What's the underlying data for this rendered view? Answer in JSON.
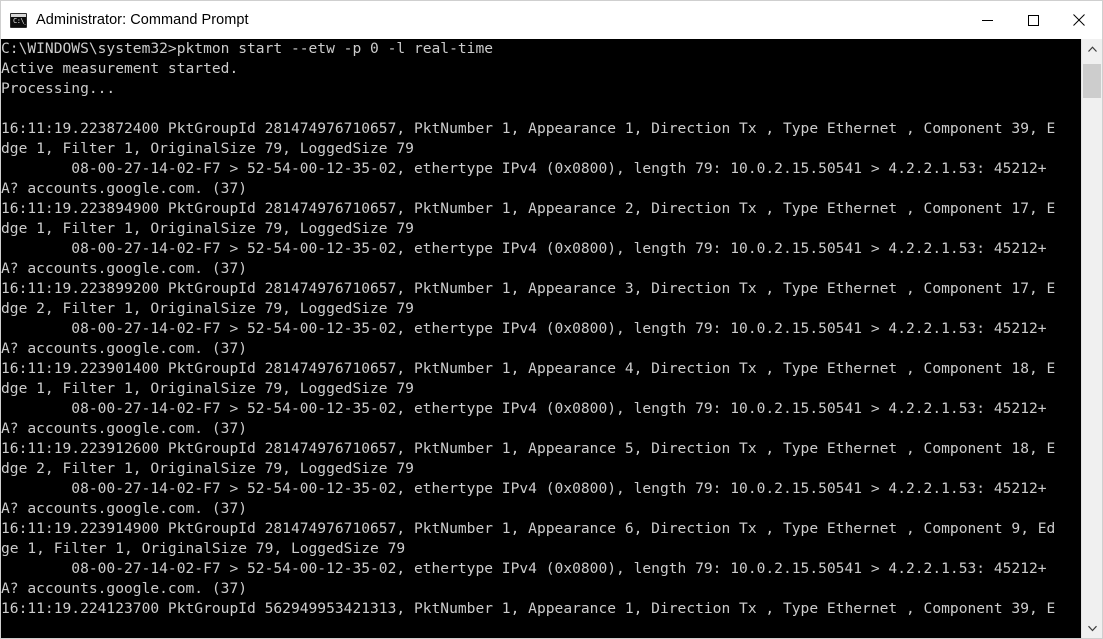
{
  "window": {
    "title": "Administrator: Command Prompt",
    "icon": "cmd-icon",
    "icon_glyph": "C:\\_",
    "background_color": "#000000",
    "text_color": "#cccccc",
    "titlebar_color": "#ffffff",
    "controls": [
      {
        "name": "minimize",
        "label": "Minimize"
      },
      {
        "name": "maximize",
        "label": "Maximize"
      },
      {
        "name": "close",
        "label": "Close"
      }
    ]
  },
  "scrollbar": {
    "up_arrow": "scroll-up",
    "down_arrow": "scroll-down",
    "thumb_position_percent": 1,
    "thumb_size_percent": 6
  },
  "console": {
    "prompt": "C:\\WINDOWS\\system32>",
    "command": "pktmon start --etw -p 0 -l real-time",
    "lines": [
      "C:\\WINDOWS\\system32>pktmon start --etw -p 0 -l real-time",
      "Active measurement started.",
      "Processing...",
      "",
      "16:11:19.223872400 PktGroupId 281474976710657, PktNumber 1, Appearance 1, Direction Tx , Type Ethernet , Component 39, E",
      "dge 1, Filter 1, OriginalSize 79, LoggedSize 79",
      "        08-00-27-14-02-F7 > 52-54-00-12-35-02, ethertype IPv4 (0x0800), length 79: 10.0.2.15.50541 > 4.2.2.1.53: 45212+",
      "A? accounts.google.com. (37)",
      "16:11:19.223894900 PktGroupId 281474976710657, PktNumber 1, Appearance 2, Direction Tx , Type Ethernet , Component 17, E",
      "dge 1, Filter 1, OriginalSize 79, LoggedSize 79",
      "        08-00-27-14-02-F7 > 52-54-00-12-35-02, ethertype IPv4 (0x0800), length 79: 10.0.2.15.50541 > 4.2.2.1.53: 45212+",
      "A? accounts.google.com. (37)",
      "16:11:19.223899200 PktGroupId 281474976710657, PktNumber 1, Appearance 3, Direction Tx , Type Ethernet , Component 17, E",
      "dge 2, Filter 1, OriginalSize 79, LoggedSize 79",
      "        08-00-27-14-02-F7 > 52-54-00-12-35-02, ethertype IPv4 (0x0800), length 79: 10.0.2.15.50541 > 4.2.2.1.53: 45212+",
      "A? accounts.google.com. (37)",
      "16:11:19.223901400 PktGroupId 281474976710657, PktNumber 1, Appearance 4, Direction Tx , Type Ethernet , Component 18, E",
      "dge 1, Filter 1, OriginalSize 79, LoggedSize 79",
      "        08-00-27-14-02-F7 > 52-54-00-12-35-02, ethertype IPv4 (0x0800), length 79: 10.0.2.15.50541 > 4.2.2.1.53: 45212+",
      "A? accounts.google.com. (37)",
      "16:11:19.223912600 PktGroupId 281474976710657, PktNumber 1, Appearance 5, Direction Tx , Type Ethernet , Component 18, E",
      "dge 2, Filter 1, OriginalSize 79, LoggedSize 79",
      "        08-00-27-14-02-F7 > 52-54-00-12-35-02, ethertype IPv4 (0x0800), length 79: 10.0.2.15.50541 > 4.2.2.1.53: 45212+",
      "A? accounts.google.com. (37)",
      "16:11:19.223914900 PktGroupId 281474976710657, PktNumber 1, Appearance 6, Direction Tx , Type Ethernet , Component 9, Ed",
      "ge 1, Filter 1, OriginalSize 79, LoggedSize 79",
      "        08-00-27-14-02-F7 > 52-54-00-12-35-02, ethertype IPv4 (0x0800), length 79: 10.0.2.15.50541 > 4.2.2.1.53: 45212+",
      "A? accounts.google.com. (37)",
      "16:11:19.224123700 PktGroupId 562949953421313, PktNumber 1, Appearance 1, Direction Tx , Type Ethernet , Component 39, E"
    ],
    "status_messages": [
      "Active measurement started.",
      "Processing..."
    ],
    "packets": [
      {
        "timestamp": "16:11:19.223872400",
        "pkt_group_id": "281474976710657",
        "pkt_number": "1",
        "appearance": "1",
        "direction": "Tx",
        "type": "Ethernet",
        "component": "39",
        "edge": "1",
        "filter": "1",
        "original_size": "79",
        "logged_size": "79",
        "src_mac": "08-00-27-14-02-F7",
        "dst_mac": "52-54-00-12-35-02",
        "ethertype": "IPv4 (0x0800)",
        "length": "79",
        "src_ip_port": "10.0.2.15.50541",
        "dst_ip_port": "4.2.2.1.53",
        "dns_query": "45212+ A? accounts.google.com. (37)"
      },
      {
        "timestamp": "16:11:19.223894900",
        "pkt_group_id": "281474976710657",
        "pkt_number": "1",
        "appearance": "2",
        "direction": "Tx",
        "type": "Ethernet",
        "component": "17",
        "edge": "1",
        "filter": "1",
        "original_size": "79",
        "logged_size": "79",
        "src_mac": "08-00-27-14-02-F7",
        "dst_mac": "52-54-00-12-35-02",
        "ethertype": "IPv4 (0x0800)",
        "length": "79",
        "src_ip_port": "10.0.2.15.50541",
        "dst_ip_port": "4.2.2.1.53",
        "dns_query": "45212+ A? accounts.google.com. (37)"
      },
      {
        "timestamp": "16:11:19.223899200",
        "pkt_group_id": "281474976710657",
        "pkt_number": "1",
        "appearance": "3",
        "direction": "Tx",
        "type": "Ethernet",
        "component": "17",
        "edge": "2",
        "filter": "1",
        "original_size": "79",
        "logged_size": "79",
        "src_mac": "08-00-27-14-02-F7",
        "dst_mac": "52-54-00-12-35-02",
        "ethertype": "IPv4 (0x0800)",
        "length": "79",
        "src_ip_port": "10.0.2.15.50541",
        "dst_ip_port": "4.2.2.1.53",
        "dns_query": "45212+ A? accounts.google.com. (37)"
      },
      {
        "timestamp": "16:11:19.223901400",
        "pkt_group_id": "281474976710657",
        "pkt_number": "1",
        "appearance": "4",
        "direction": "Tx",
        "type": "Ethernet",
        "component": "18",
        "edge": "1",
        "filter": "1",
        "original_size": "79",
        "logged_size": "79",
        "src_mac": "08-00-27-14-02-F7",
        "dst_mac": "52-54-00-12-35-02",
        "ethertype": "IPv4 (0x0800)",
        "length": "79",
        "src_ip_port": "10.0.2.15.50541",
        "dst_ip_port": "4.2.2.1.53",
        "dns_query": "45212+ A? accounts.google.com. (37)"
      },
      {
        "timestamp": "16:11:19.223912600",
        "pkt_group_id": "281474976710657",
        "pkt_number": "1",
        "appearance": "5",
        "direction": "Tx",
        "type": "Ethernet",
        "component": "18",
        "edge": "2",
        "filter": "1",
        "original_size": "79",
        "logged_size": "79",
        "src_mac": "08-00-27-14-02-F7",
        "dst_mac": "52-54-00-12-35-02",
        "ethertype": "IPv4 (0x0800)",
        "length": "79",
        "src_ip_port": "10.0.2.15.50541",
        "dst_ip_port": "4.2.2.1.53",
        "dns_query": "45212+ A? accounts.google.com. (37)"
      },
      {
        "timestamp": "16:11:19.223914900",
        "pkt_group_id": "281474976710657",
        "pkt_number": "1",
        "appearance": "6",
        "direction": "Tx",
        "type": "Ethernet",
        "component": "9",
        "edge": "1",
        "filter": "1",
        "original_size": "79",
        "logged_size": "79",
        "src_mac": "08-00-27-14-02-F7",
        "dst_mac": "52-54-00-12-35-02",
        "ethertype": "IPv4 (0x0800)",
        "length": "79",
        "src_ip_port": "10.0.2.15.50541",
        "dst_ip_port": "4.2.2.1.53",
        "dns_query": "45212+ A? accounts.google.com. (37)"
      },
      {
        "timestamp": "16:11:19.224123700",
        "pkt_group_id": "562949953421313",
        "pkt_number": "1",
        "appearance": "1",
        "direction": "Tx",
        "type": "Ethernet",
        "component": "39",
        "edge": "",
        "filter": "",
        "original_size": "",
        "logged_size": "",
        "src_mac": "",
        "dst_mac": "",
        "ethertype": "",
        "length": "",
        "src_ip_port": "",
        "dst_ip_port": "",
        "dns_query": ""
      }
    ]
  }
}
